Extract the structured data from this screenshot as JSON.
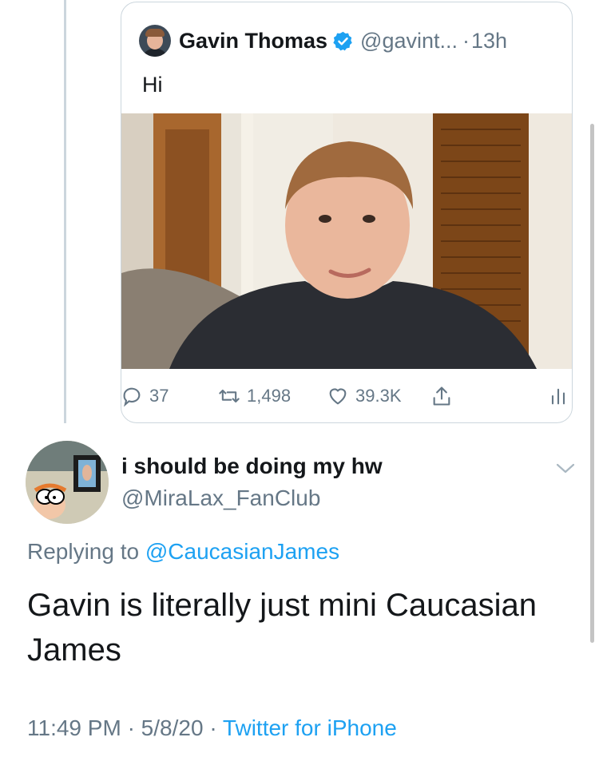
{
  "quoted_tweet": {
    "author_name": "Gavin Thomas",
    "handle": "@gavint...",
    "separator": "·",
    "time": "13h",
    "text": "Hi",
    "media_description": "photo"
  },
  "actions": {
    "replies": "37",
    "retweets": "1,498",
    "likes": "39.3K"
  },
  "reply": {
    "display_name": "i should be doing my hw",
    "handle": "@MiraLax_FanClub",
    "replying_to_prefix": "Replying to",
    "replying_to_handle": "@CaucasianJames",
    "text": "Gavin is literally just mini Caucasian James",
    "time": "11:49 PM",
    "date": "5/8/20",
    "separator": "·",
    "source": "Twitter for iPhone"
  },
  "colors": {
    "link": "#1da1f2",
    "muted": "#657786",
    "text": "#14171a",
    "border": "#ccd6dd"
  }
}
